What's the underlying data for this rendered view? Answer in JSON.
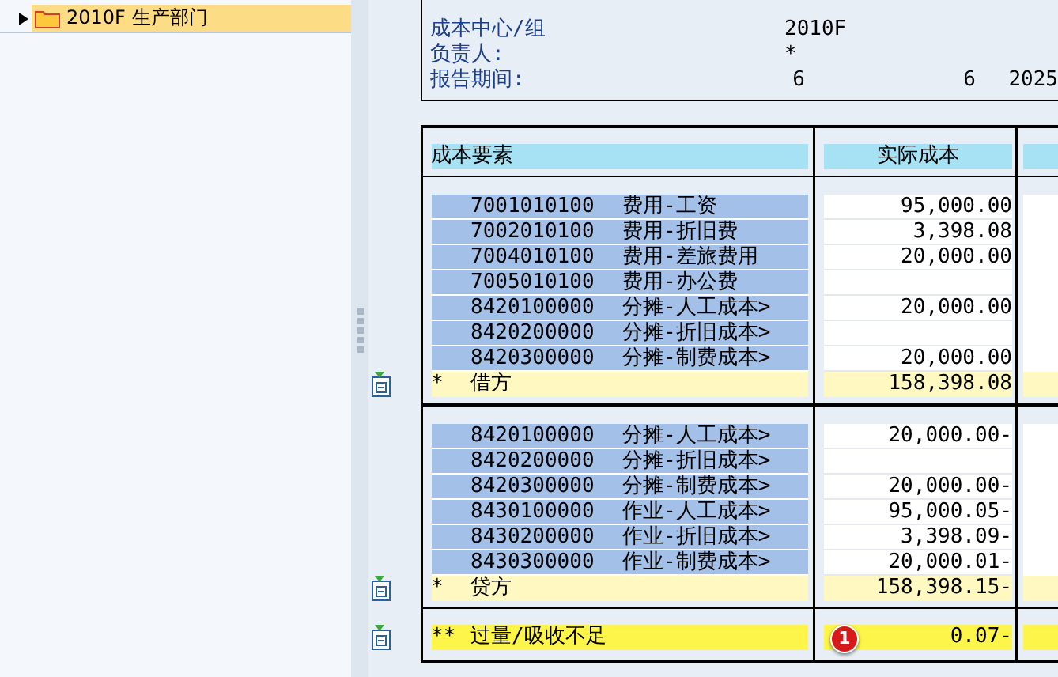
{
  "tree": {
    "items": [
      {
        "label": "2010F 生产部门",
        "selected": true,
        "expanded": false
      }
    ]
  },
  "header": {
    "fields": [
      {
        "label": "成本中心/组",
        "values": [
          "2010F"
        ]
      },
      {
        "label": "负责人:",
        "values": [
          "*"
        ]
      },
      {
        "label": "报告期间:",
        "values": [
          "6",
          "6",
          "2025"
        ]
      }
    ]
  },
  "table": {
    "columns": [
      "成本要素",
      "实际成本"
    ],
    "sections": [
      {
        "rows": [
          {
            "code": "7001010100",
            "name": "费用-工资",
            "amount": "95,000.00"
          },
          {
            "code": "7002010100",
            "name": "费用-折旧费",
            "amount": "3,398.08"
          },
          {
            "code": "7004010100",
            "name": "费用-差旅费用",
            "amount": "20,000.00"
          },
          {
            "code": "7005010100",
            "name": "费用-办公费",
            "amount": ""
          },
          {
            "code": "8420100000",
            "name": "分摊-人工成本>",
            "amount": "20,000.00"
          },
          {
            "code": "8420200000",
            "name": "分摊-折旧成本>",
            "amount": ""
          },
          {
            "code": "8420300000",
            "name": "分摊-制费成本>",
            "amount": "20,000.00"
          }
        ],
        "total": {
          "marker": "*",
          "label": "借方",
          "amount": "158,398.08"
        }
      },
      {
        "rows": [
          {
            "code": "8420100000",
            "name": "分摊-人工成本>",
            "amount": "20,000.00-"
          },
          {
            "code": "8420200000",
            "name": "分摊-折旧成本>",
            "amount": ""
          },
          {
            "code": "8420300000",
            "name": "分摊-制费成本>",
            "amount": "20,000.00-"
          },
          {
            "code": "8430100000",
            "name": "作业-人工成本>",
            "amount": "95,000.05-"
          },
          {
            "code": "8430200000",
            "name": "作业-折旧成本>",
            "amount": "3,398.09-"
          },
          {
            "code": "8430300000",
            "name": "作业-制费成本>",
            "amount": "20,000.01-"
          }
        ],
        "total": {
          "marker": "*",
          "label": "贷方",
          "amount": "158,398.15-"
        }
      }
    ],
    "grand_total": {
      "marker": "**",
      "label": "过量/吸收不足",
      "amount": "0.07-",
      "callout": "1"
    }
  }
}
